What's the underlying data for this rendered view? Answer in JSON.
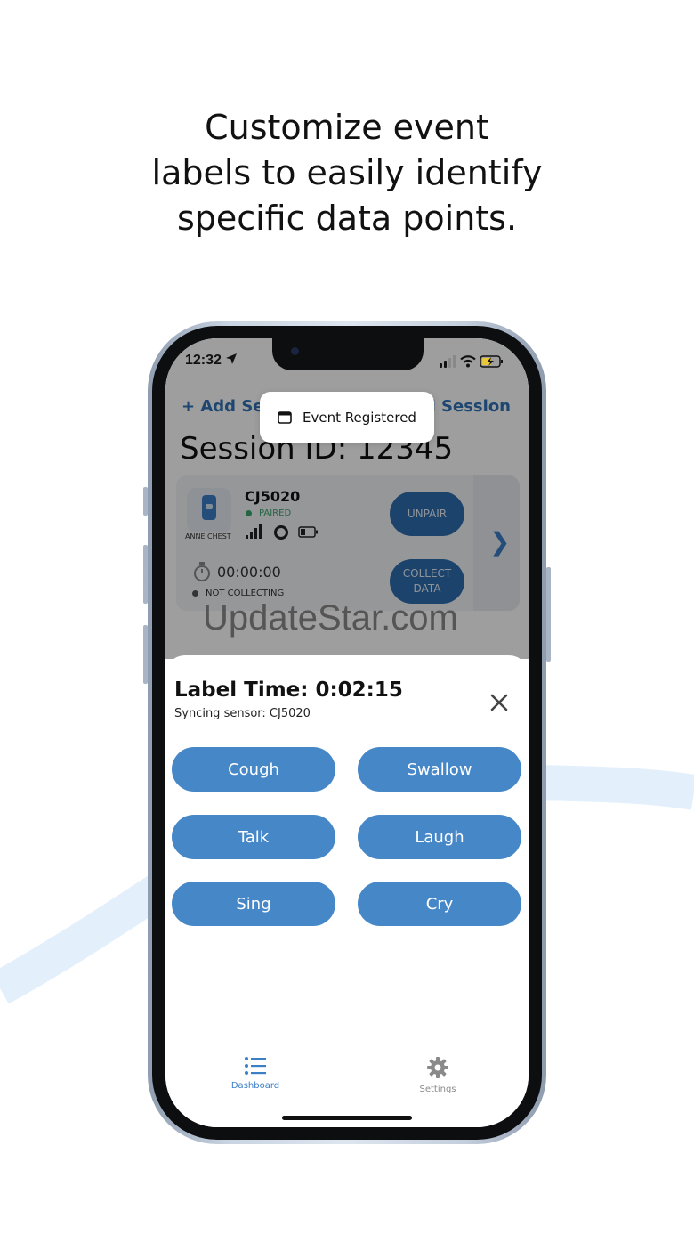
{
  "headline": {
    "line1": "Customize event",
    "line2": "labels to easily identify",
    "line3": "specific data points."
  },
  "status_bar": {
    "time": "12:32"
  },
  "background_screen": {
    "add_sensor_label": "+ Add Sen",
    "end_session_label": "nd Session",
    "session_id": "Session ID: 12345",
    "sensor": {
      "name": "CJ5020",
      "status": "PAIRED",
      "location": "ANNE CHEST",
      "unpair_label": "UNPAIR",
      "timer": "00:00:00",
      "collect_status": "NOT COLLECTING",
      "collect_label_line1": "COLLECT",
      "collect_label_line2": "DATA"
    },
    "watermark": "UpdateStar.com"
  },
  "toast": {
    "text": "Event Registered"
  },
  "label_sheet": {
    "title": "Label Time: 0:02:15",
    "subtitle": "Syncing sensor: CJ5020",
    "buttons": [
      "Cough",
      "Swallow",
      "Talk",
      "Laugh",
      "Sing",
      "Cry"
    ]
  },
  "tab_bar": {
    "dashboard_label": "Dashboard",
    "settings_label": "Settings",
    "active_color": "#3b7fc4",
    "inactive_color": "#8a8a8a"
  },
  "colors": {
    "accent": "#2f72b5",
    "button": "#4587c7",
    "paired": "#3aa46e",
    "swoosh": "#e3f0fc"
  }
}
